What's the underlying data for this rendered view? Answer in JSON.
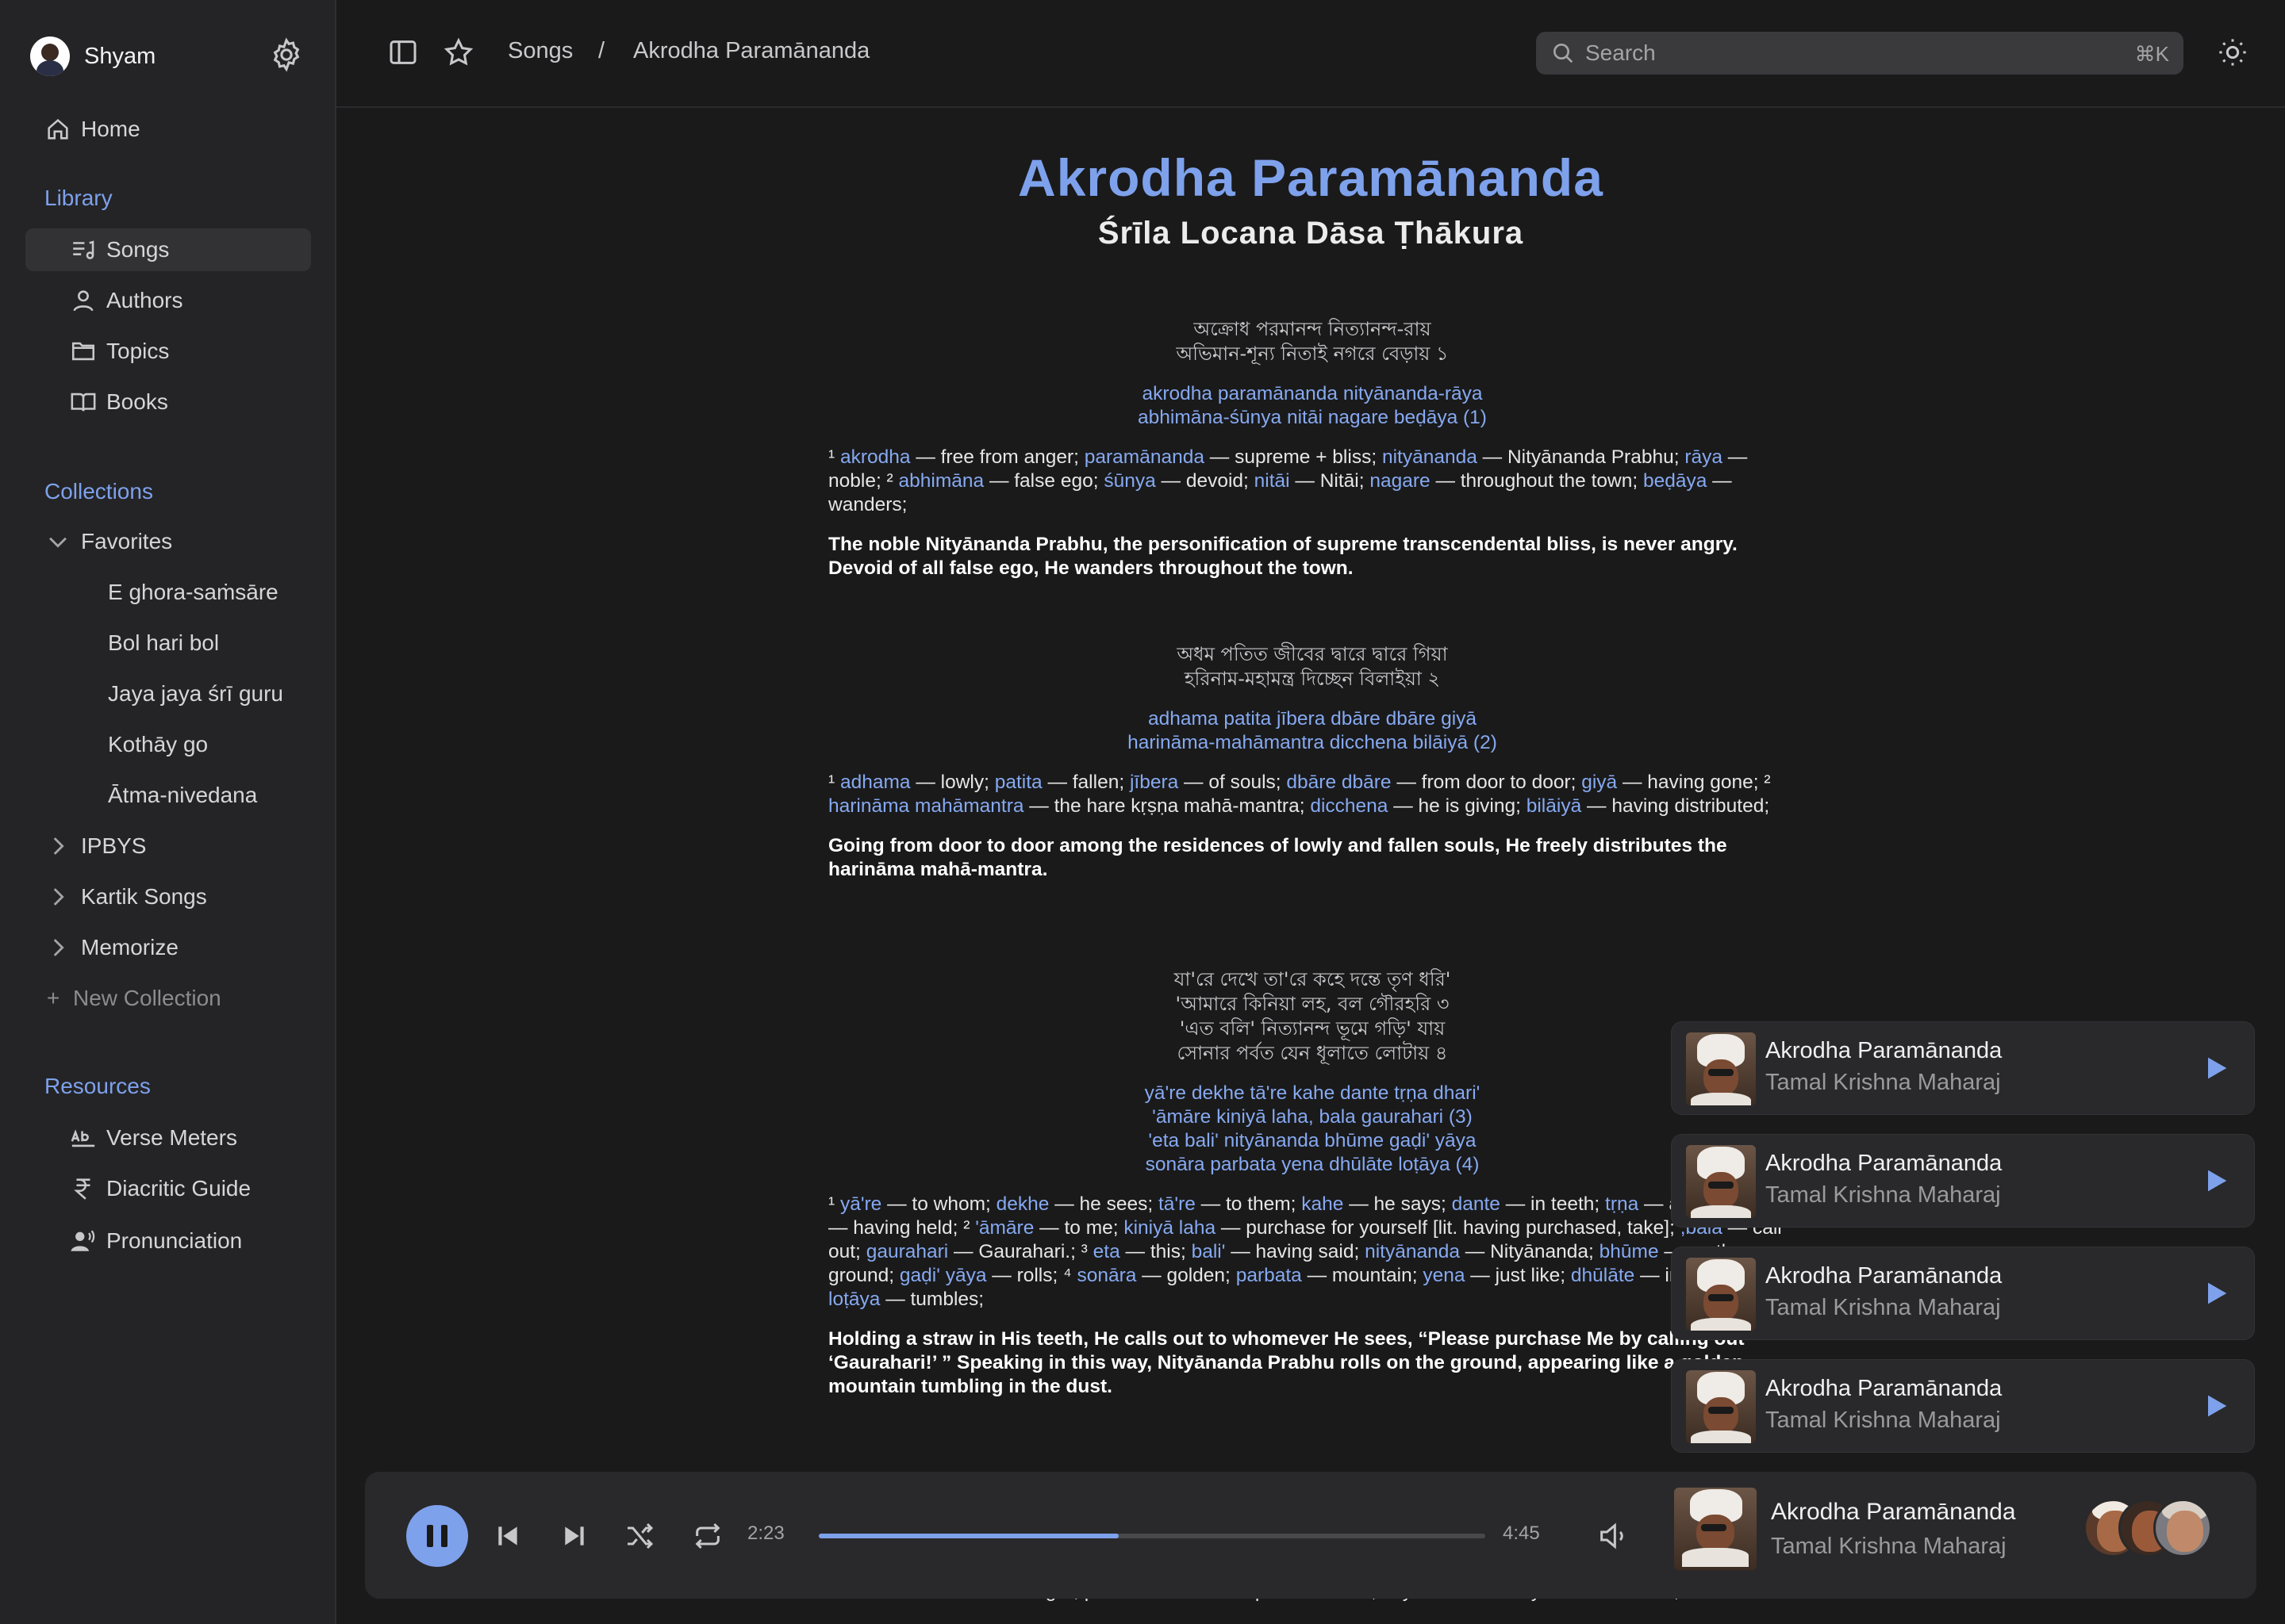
{
  "sidebar": {
    "user_name": "Shyam",
    "home_label": "Home",
    "library_title": "Library",
    "library": [
      {
        "label": "Songs"
      },
      {
        "label": "Authors"
      },
      {
        "label": "Topics"
      },
      {
        "label": "Books"
      }
    ],
    "collections_title": "Collections",
    "favorites": {
      "label": "Favorites",
      "items": [
        "E ghora-saṁsāre",
        "Bol hari bol",
        "Jaya jaya śrī guru",
        "Kothāy go",
        "Ātma-nivedana"
      ]
    },
    "collections": [
      "IPBYS",
      "Kartik Songs",
      "Memorize"
    ],
    "new_collection": "New Collection",
    "new_collection_plus": "+",
    "resources_title": "Resources",
    "resources": [
      "Verse Meters",
      "Diacritic Guide",
      "Pronunciation"
    ]
  },
  "topbar": {
    "breadcrumb": [
      "Songs",
      "/",
      "Akrodha Paramānanda"
    ],
    "search_placeholder": "Search",
    "search_shortcut": "⌘K"
  },
  "song": {
    "title": "Akrodha Paramānanda",
    "author": "Śrīla Locana Dāsa Ṭhākura",
    "verses": [
      {
        "bengali": [
          "অক্রোধ পরমানন্দ নিত্যানন্দ-রায়",
          "অভিমান-শূন্য নিতাই নগরে বেড়ায়     ১"
        ],
        "translit": [
          "akrodha paramānanda nityānanda-rāya",
          "abhimāna-śūnya nitāi nagare beḍāya (1)"
        ],
        "words": [
          [
            "¹ ",
            "akrodha",
            " — free from anger;  "
          ],
          [
            "",
            "paramānanda",
            " — supreme + bliss;  "
          ],
          [
            "",
            "nityānanda",
            " — Nityānanda Prabhu; "
          ],
          [
            "",
            "rāya",
            " — noble;  ² "
          ],
          [
            "",
            "abhimāna",
            " — false ego;  "
          ],
          [
            "",
            "śūnya",
            " — devoid;  "
          ],
          [
            "",
            "nitāi",
            " — Nitāi;  "
          ],
          [
            "",
            "nagare",
            " — throughout the town;  "
          ],
          [
            "",
            "beḍāya",
            " — wanders;"
          ]
        ],
        "translation": "The noble Nityānanda Prabhu, the personification of supreme transcendental bliss, is never angry. Devoid of all false ego, He wanders throughout the town."
      },
      {
        "bengali": [
          "অধম পতিত জীবের দ্বারে দ্বারে গিয়া",
          "হরিনাম-মহামন্ত্র দিচ্ছেন বিলাইয়া     ২"
        ],
        "translit": [
          "adhama patita jībera dbāre dbāre giyā",
          "harināma-mahāmantra dicchena bilāiyā (2)"
        ],
        "words": [
          [
            "¹ ",
            "adhama",
            " — lowly;  "
          ],
          [
            "",
            "patita",
            " — fallen;  "
          ],
          [
            "",
            "jībera",
            " — of souls;  "
          ],
          [
            "",
            "dbāre dbāre",
            " — from door to door;  "
          ],
          [
            "",
            "giyā",
            " — having gone;  ² "
          ],
          [
            "",
            "harināma mahāmantra",
            " — the hare kṛṣṇa mahā-mantra;  "
          ],
          [
            "",
            "dicchena",
            " — he is giving; "
          ],
          [
            "",
            "bilāiyā",
            " — having distributed;"
          ]
        ],
        "translation": "Going from door to door among the residences of lowly and fallen souls, He freely distributes the harināma mahā-mantra."
      },
      {
        "bengali": [
          "যা'রে দেখে তা'রে কহে দন্তে তৃণ ধরি'",
          "'আমারে কিনিয়া লহ, বল গৌরহরি     ৩",
          "'এত বলি' নিত্যানন্দ ভূমে গড়ি' যায়",
          "সোনার পর্বত যেন ধূলাতে লোটায়     ৪"
        ],
        "translit": [
          "yā're dekhe tā're kahe dante tṛṇa dhari'",
          "'āmāre kiniyā laha, bala gaurahari (3)",
          "'eta bali' nityānanda bhūme gaḍi' yāya",
          "sonāra parbata yena dhūlāte loṭāya (4)"
        ],
        "words": [
          [
            "¹ ",
            "yā're",
            " — to whom;  "
          ],
          [
            "",
            "dekhe",
            " — he sees;  "
          ],
          [
            "",
            "tā're",
            " — to them;  "
          ],
          [
            "",
            "kahe",
            " — he says;  "
          ],
          [
            "",
            "dante",
            " — in teeth; "
          ],
          [
            "",
            "tṛṇa",
            " — a straw;  "
          ],
          [
            "",
            "dhari'",
            " — having held;  ² "
          ],
          [
            "",
            "'āmāre",
            " — to me;  "
          ],
          [
            "",
            "kiniyā laha",
            " — purchase for yourself [lit. having purchased, take];  "
          ],
          [
            "",
            ",bala",
            " — call out;  "
          ],
          [
            "",
            "gaurahari",
            " — Gaurahari.;  ³ "
          ],
          [
            "",
            "eta",
            " — this;  "
          ],
          [
            "",
            "bali'",
            " — having said;  "
          ],
          [
            "",
            "nityānanda",
            " — Nityānanda;  "
          ],
          [
            "",
            "bhūme",
            " — on the ground;  "
          ],
          [
            "",
            "gaḍi' yāya",
            " — rolls;  ⁴ "
          ],
          [
            "",
            "sonāra",
            " — golden;  "
          ],
          [
            "",
            "parbata",
            " — mountain;  "
          ],
          [
            "",
            "yena",
            " — just like;  "
          ],
          [
            "",
            "dhūlāte",
            " — in the dust;  "
          ],
          [
            "",
            "loṭāya",
            " — tumbles;"
          ]
        ],
        "translation": "Holding a straw in His teeth, He calls out to whomever He sees, “Please purchase Me by calling out ‘Gaurahari!’ ” Speaking in this way, Nityānanda Prabhu rolls on the ground, appearing like a golden mountain tumbling in the dust."
      }
    ],
    "peek_words": "¹ akrodha — free from anger;  paramānanda — supreme + bliss;  nityānanda — Nityānanda Prabhu;"
  },
  "queue": [
    {
      "title": "Akrodha Paramānanda",
      "artist": "Tamal Krishna Maharaj"
    },
    {
      "title": "Akrodha Paramānanda",
      "artist": "Tamal Krishna Maharaj"
    },
    {
      "title": "Akrodha Paramānanda",
      "artist": "Tamal Krishna Maharaj"
    },
    {
      "title": "Akrodha Paramānanda",
      "artist": "Tamal Krishna Maharaj"
    }
  ],
  "player": {
    "elapsed": "2:23",
    "duration": "4:45",
    "progress_fraction": 0.45,
    "title": "Akrodha Paramānanda",
    "artist": "Tamal Krishna Maharaj"
  },
  "colors": {
    "accent": "#7ea1ec",
    "background": "#1a1a1b",
    "sidebar": "#242426",
    "card": "#29292b"
  }
}
